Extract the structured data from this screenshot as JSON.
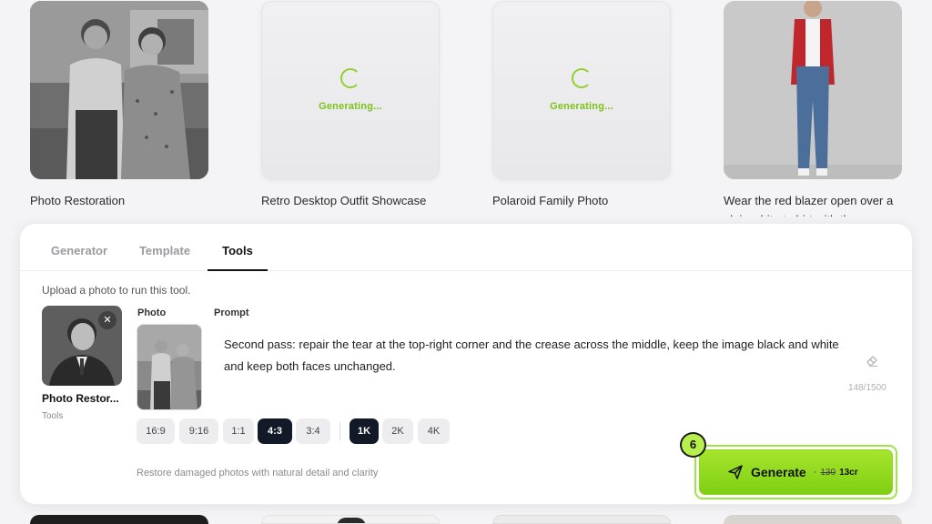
{
  "gallery": {
    "cards": [
      {
        "title": "Photo Restoration",
        "state": "image",
        "image": "vintage-couple-photo"
      },
      {
        "title": "Retro Desktop Outfit Showcase",
        "state": "loading",
        "status": "Generating..."
      },
      {
        "title": "Polaroid Family Photo",
        "state": "loading",
        "status": "Generating..."
      },
      {
        "title": "Wear the red blazer open over a plain white t-shirt with the...",
        "state": "image",
        "image": "woman-red-blazer-photo"
      }
    ]
  },
  "panel": {
    "tabs": [
      {
        "label": "Generator",
        "active": false
      },
      {
        "label": "Template",
        "active": false
      },
      {
        "label": "Tools",
        "active": true
      }
    ],
    "hint": "Upload a photo to run this tool.",
    "tool": {
      "name": "Photo Restor...",
      "category": "Tools",
      "close_icon": "close-icon",
      "image": "vintage-portrait-man"
    },
    "photo_label": "Photo",
    "prompt_label": "Prompt",
    "prompt": "Second pass: repair the tear at the top-right corner and the crease across the middle, keep the image black and white and keep both faces unchanged.",
    "counter": "148/1500",
    "aspect_ratios": [
      {
        "label": "16:9",
        "selected": false
      },
      {
        "label": "9:16",
        "selected": false
      },
      {
        "label": "1:1",
        "selected": false
      },
      {
        "label": "4:3",
        "selected": true
      },
      {
        "label": "3:4",
        "selected": false
      }
    ],
    "resolutions": [
      {
        "label": "1K",
        "selected": true
      },
      {
        "label": "2K",
        "selected": false
      },
      {
        "label": "4K",
        "selected": false
      }
    ],
    "description": "Restore damaged photos with natural detail and clarity",
    "generate": {
      "label": "Generate",
      "separator": "·",
      "old_price": "130",
      "new_price": "13cr",
      "badge": "6",
      "icon": "send-icon"
    }
  },
  "colors": {
    "accent": "#8fd12a",
    "dark_chip": "#121a28"
  }
}
